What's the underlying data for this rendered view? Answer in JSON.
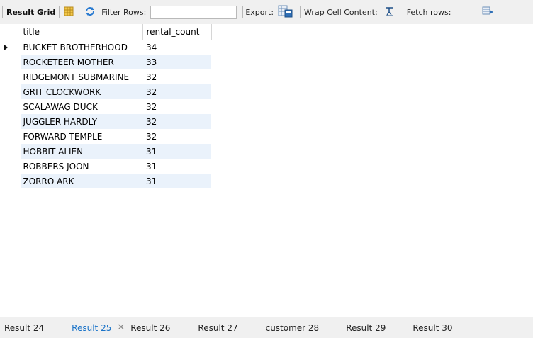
{
  "toolbar": {
    "result_grid": "Result Grid",
    "filter_rows": "Filter Rows:",
    "filter_value": "",
    "export": "Export:",
    "wrap_cell": "Wrap Cell Content:",
    "fetch_rows": "Fetch rows:"
  },
  "grid": {
    "columns": [
      "title",
      "rental_count"
    ],
    "rows": [
      {
        "title": "BUCKET BROTHERHOOD",
        "rental_count": "34"
      },
      {
        "title": "ROCKETEER MOTHER",
        "rental_count": "33"
      },
      {
        "title": "RIDGEMONT SUBMARINE",
        "rental_count": "32"
      },
      {
        "title": "GRIT CLOCKWORK",
        "rental_count": "32"
      },
      {
        "title": "SCALAWAG DUCK",
        "rental_count": "32"
      },
      {
        "title": "JUGGLER HARDLY",
        "rental_count": "32"
      },
      {
        "title": "FORWARD TEMPLE",
        "rental_count": "32"
      },
      {
        "title": "HOBBIT ALIEN",
        "rental_count": "31"
      },
      {
        "title": "ROBBERS JOON",
        "rental_count": "31"
      },
      {
        "title": "ZORRO ARK",
        "rental_count": "31"
      }
    ]
  },
  "tabs": [
    {
      "label": "Result 24",
      "active": false
    },
    {
      "label": "Result 25",
      "active": true
    },
    {
      "label": "Result 26",
      "active": false
    },
    {
      "label": "Result 27",
      "active": false
    },
    {
      "label": "customer 28",
      "active": false
    },
    {
      "label": "Result 29",
      "active": false
    },
    {
      "label": "Result 30",
      "active": false
    }
  ],
  "colors": {
    "active_tab": "#1a73c8",
    "row_alt": "#eaf2fb",
    "toolbar_bg": "#f0f0f0"
  }
}
